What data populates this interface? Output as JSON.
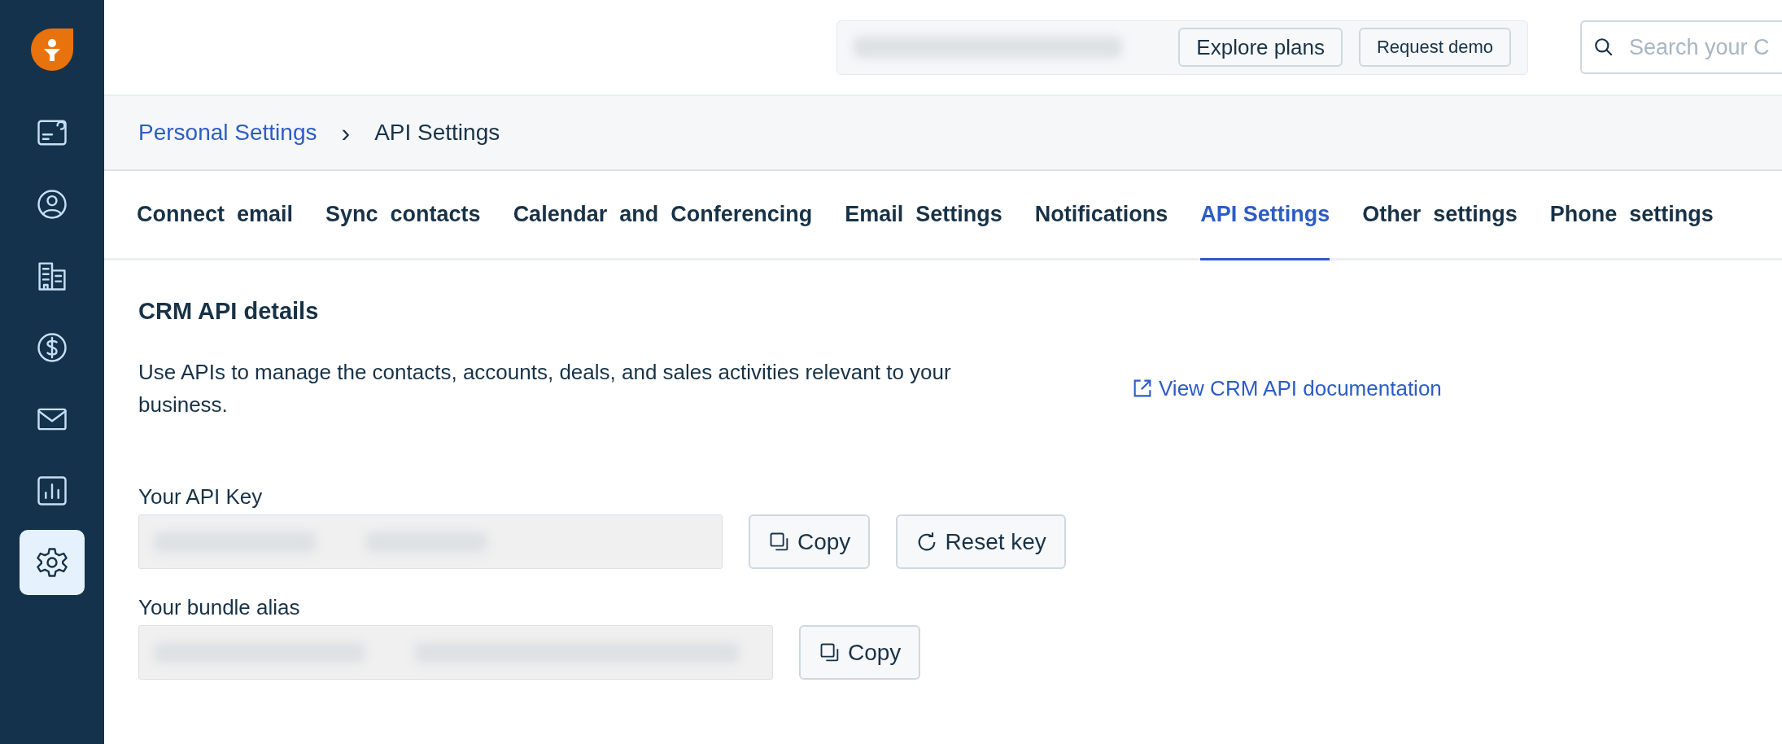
{
  "sidebar": {
    "items": [
      {
        "kind": "dashboard",
        "selected": false
      },
      {
        "kind": "contact",
        "selected": false
      },
      {
        "kind": "accounts",
        "selected": false
      },
      {
        "kind": "deals",
        "selected": false
      },
      {
        "kind": "email",
        "selected": false
      },
      {
        "kind": "reports",
        "selected": false
      },
      {
        "kind": "settings",
        "selected": true
      }
    ]
  },
  "topbar": {
    "buttons": [
      "Explore plans",
      "Request demo"
    ],
    "search": {
      "placeholder": "Search your C"
    }
  },
  "breadcrumb": {
    "parent": "Personal Settings",
    "separator": "›",
    "current": "API Settings"
  },
  "tabs": [
    {
      "label": "Connect  email",
      "selected": false
    },
    {
      "label": "Sync  contacts",
      "selected": false
    },
    {
      "label": "Calendar  and  Conferencing",
      "selected": false
    },
    {
      "label": "Email  Settings",
      "selected": false
    },
    {
      "label": "Notifications",
      "selected": false
    },
    {
      "label": "API Settings",
      "selected": true
    },
    {
      "label": "Other  settings",
      "selected": false
    },
    {
      "label": "Phone  settings",
      "selected": false
    }
  ],
  "section": {
    "title": "CRM API details",
    "description": "Use APIs to manage the contacts, accounts, deals, and sales activities relevant to your business.",
    "link": "View CRM API documentation",
    "fields": [
      {
        "label": "Your API Key",
        "buttons": [
          {
            "kind": "copy",
            "label": "Copy"
          },
          {
            "kind": "reset",
            "label": "Reset key"
          }
        ]
      },
      {
        "label": "Your bundle alias",
        "buttons": [
          {
            "kind": "copy",
            "label": "Copy"
          }
        ]
      }
    ]
  }
}
